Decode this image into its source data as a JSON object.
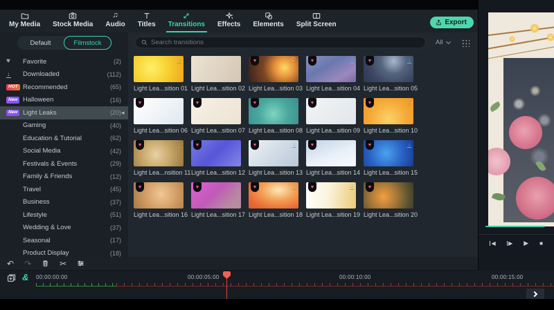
{
  "header": {
    "tabs": [
      {
        "label": "My Media",
        "icon": "folder-icon"
      },
      {
        "label": "Stock Media",
        "icon": "camera-icon"
      },
      {
        "label": "Audio",
        "icon": "music-icon"
      },
      {
        "label": "Titles",
        "icon": "titles-icon"
      },
      {
        "label": "Transitions",
        "icon": "transitions-icon",
        "active": true
      },
      {
        "label": "Effects",
        "icon": "effects-icon"
      },
      {
        "label": "Elements",
        "icon": "elements-icon"
      },
      {
        "label": "Split Screen",
        "icon": "split-screen-icon"
      }
    ],
    "export_label": "Export"
  },
  "sidebar": {
    "tabs": [
      {
        "label": "Default"
      },
      {
        "label": "Filmstock",
        "active": true
      }
    ],
    "items": [
      {
        "label": "Favorite",
        "count": "(2)",
        "icon": "heart-icon"
      },
      {
        "label": "Downloaded",
        "count": "(112)",
        "icon": "download-icon"
      },
      {
        "label": "Recommended",
        "count": "(65)",
        "badge": "HOT"
      },
      {
        "label": "Halloween",
        "count": "(16)",
        "badge": "New"
      },
      {
        "label": "Light Leaks",
        "count": "(20)",
        "badge": "New",
        "selected": true
      },
      {
        "label": "Gaming",
        "count": "(40)"
      },
      {
        "label": "Education & Tutorial",
        "count": "(62)"
      },
      {
        "label": "Social Media",
        "count": "(42)"
      },
      {
        "label": "Festivals & Events",
        "count": "(29)"
      },
      {
        "label": "Family & Friends",
        "count": "(12)"
      },
      {
        "label": "Travel",
        "count": "(45)"
      },
      {
        "label": "Business",
        "count": "(37)"
      },
      {
        "label": "Lifestyle",
        "count": "(51)"
      },
      {
        "label": "Wedding & Love",
        "count": "(37)"
      },
      {
        "label": "Seasonal",
        "count": "(17)"
      },
      {
        "label": "Product Display",
        "count": "(18)"
      }
    ]
  },
  "search": {
    "placeholder": "Search transitions",
    "filter_label": "All"
  },
  "grid": {
    "items": [
      {
        "label": "Light Lea...sition 01",
        "premium": false,
        "download": true,
        "heart": false,
        "bg": "radial-gradient(circle at 35% 45%, #fdf06a 0%, #f8d435 45%, #efa31c 100%)"
      },
      {
        "label": "Light Lea...sition 02",
        "premium": false,
        "download": false,
        "heart": false,
        "bg": "linear-gradient(120deg, #ece3d4 0%, #ded2c0 60%, #d4c6b2 100%)"
      },
      {
        "label": "Light Lea...sition 03",
        "premium": true,
        "download": false,
        "heart": true,
        "bg": "radial-gradient(circle at 72% 45%, #ffd966 0%, #e8923a 25%, #7a4526 55%, #38201a 100%)"
      },
      {
        "label": "Light Lea...sition 04",
        "premium": true,
        "download": true,
        "heart": false,
        "bg": "linear-gradient(150deg, #8a90c0 0%, #6a78b0 40%, #9a88be 75%, #7a6aa8 100%)"
      },
      {
        "label": "Light Lea...sition 05",
        "premium": true,
        "download": true,
        "heart": false,
        "bg": "radial-gradient(circle at 60% 20%, #aab8cc 0%, #55647e 35%, #3a4560 70%, #2e3850 100%)"
      },
      {
        "label": "Light Lea...sition 06",
        "premium": true,
        "download": false,
        "heart": false,
        "bg": "linear-gradient(135deg, #ffffff 0%, #eef2f6 60%, #dde6f0 100%)"
      },
      {
        "label": "Light Lea...sition 07",
        "premium": true,
        "download": false,
        "heart": false,
        "bg": "linear-gradient(135deg, #f6f1e6 0%, #ece4d2 100%)"
      },
      {
        "label": "Light Lea...sition 08",
        "premium": true,
        "download": false,
        "heart": false,
        "bg": "radial-gradient(circle at 50% 60%, #7fd4c0 0%, #4aa89e 50%, #3d8d90 100%)"
      },
      {
        "label": "Light Lea...sition 09",
        "premium": true,
        "download": false,
        "heart": false,
        "bg": "linear-gradient(135deg, #f2f4f6 0%, #e2e6ea 100%)"
      },
      {
        "label": "Light Lea...sition 10",
        "premium": true,
        "download": true,
        "heart": false,
        "bg": "radial-gradient(circle at 50% 80%, #fbd26a 0%, #f5ab38 55%, #ef9428 100%)"
      },
      {
        "label": "Light Lea...nsition 11",
        "premium": true,
        "download": true,
        "heart": false,
        "bg": "radial-gradient(circle at 45% 55%, #e6d2a4 0%, #c9a86a 45%, #96743e 100%)"
      },
      {
        "label": "Light Lea...sition 12",
        "premium": true,
        "download": false,
        "heart": false,
        "bg": "linear-gradient(135deg, #7a7ae6 0%, #5656d8 50%, #8484ec 100%)"
      },
      {
        "label": "Light Lea...sition 13",
        "premium": true,
        "download": true,
        "heart": false,
        "bg": "linear-gradient(135deg, #eef2f6 0%, #ccd8e4 60%, #b8c8da 100%)"
      },
      {
        "label": "Light Lea...sition 14",
        "premium": true,
        "download": false,
        "heart": false,
        "bg": "linear-gradient(160deg, #c2d2e6 0%, #e8f0f8 55%, #f8fbff 100%)"
      },
      {
        "label": "Light Lea...sition 15",
        "premium": true,
        "download": true,
        "heart": false,
        "bg": "radial-gradient(circle at 45% 50%, #4aa2ee 0%, #2a62c4 55%, #173c92 100%)"
      },
      {
        "label": "Light Lea...sition 16",
        "premium": true,
        "download": false,
        "heart": false,
        "bg": "radial-gradient(circle at 55% 45%, #f0c896 0%, #cf9a62 55%, #a87848 100%)"
      },
      {
        "label": "Light Lea...sition 17",
        "premium": true,
        "download": true,
        "heart": false,
        "bg": "linear-gradient(135deg, #e061d6 0%, #c05ab8 45%, #b88aa0 80%)"
      },
      {
        "label": "Light Lea...sition 18",
        "premium": true,
        "download": true,
        "heart": false,
        "bg": "radial-gradient(ellipse at 60% 30%, #fbe9b8 0%, #f3a054 40%, #ea6a36 75%, #e25c30 100%)"
      },
      {
        "label": "Light Lea...sition 19",
        "premium": true,
        "download": true,
        "heart": false,
        "bg": "linear-gradient(100deg, #ffffff 0%, #faf4dc 45%, #ecc976 100%)"
      },
      {
        "label": "Light Lea...sition 20",
        "premium": true,
        "download": false,
        "heart": false,
        "bg": "radial-gradient(circle at 40% 55%, #f0a040 0%, #a87838 40%, #5c5432 75%, #3e3c26 100%)"
      }
    ]
  },
  "preview": {
    "controls": [
      "previous-frame-icon",
      "next-frame-icon",
      "play-icon",
      "stop-icon"
    ]
  },
  "toolbar": {
    "icons": [
      "undo-icon",
      "redo-icon",
      "delete-icon",
      "split-scissors-icon",
      "adjust-icon"
    ]
  },
  "timeline": {
    "icons": [
      "copy-icon",
      "snap-icon"
    ],
    "timestamps": [
      "00:00:00:00",
      "00:00:05:00",
      "00:00:10:00",
      "00:00:15:00"
    ]
  },
  "colors": {
    "accent": "#3fd2ae",
    "export_button": "#4fd6ad",
    "hot_badge_start": "#e83c50",
    "hot_badge_end": "#ef7231",
    "new_badge": "#8a53f0",
    "playhead": "#f25f52",
    "ruler_green": "#3f9c4a",
    "ruler_red": "#9c3a3e",
    "download_icon": "#35cfa6",
    "premium_gem": "#f0558c"
  }
}
